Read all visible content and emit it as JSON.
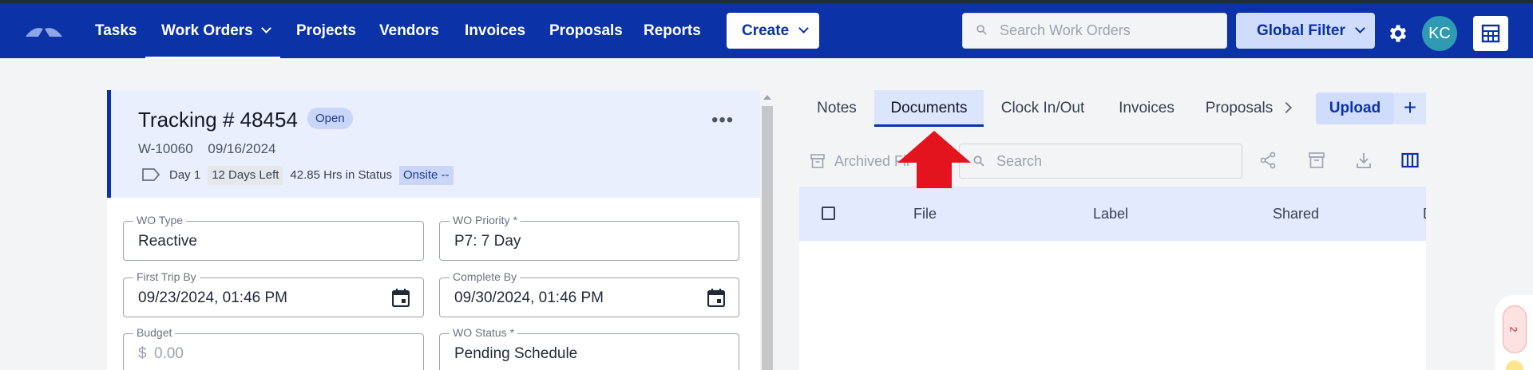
{
  "nav": {
    "items": [
      {
        "label": "Tasks",
        "dropdown": false
      },
      {
        "label": "Work Orders",
        "dropdown": true,
        "active": true
      },
      {
        "label": "Projects",
        "dropdown": false
      },
      {
        "label": "Vendors",
        "dropdown": false
      },
      {
        "label": "Invoices",
        "dropdown": false
      },
      {
        "label": "Proposals",
        "dropdown": false
      },
      {
        "label": "Reports",
        "dropdown": false
      }
    ],
    "create_label": "Create",
    "search_placeholder": "Search Work Orders",
    "global_filter_label": "Global Filter",
    "avatar_initials": "KC"
  },
  "work_order": {
    "tracking_label": "Tracking # 48454",
    "status": "Open",
    "wo_number": "W-10060",
    "date": "09/16/2024",
    "day": "Day 1",
    "days_left": "12 Days Left",
    "hrs_in_status": "42.85 Hrs in Status",
    "onsite": "Onsite --",
    "fields": {
      "wo_type": {
        "label": "WO Type",
        "value": "Reactive"
      },
      "wo_priority": {
        "label": "WO Priority *",
        "value": "P7: 7 Day"
      },
      "first_trip_by": {
        "label": "First Trip By",
        "value": "09/23/2024, 01:46 PM"
      },
      "complete_by": {
        "label": "Complete By",
        "value": "09/30/2024, 01:46 PM"
      },
      "budget": {
        "label": "Budget",
        "prefix": "$",
        "placeholder": "0.00"
      },
      "wo_status": {
        "label": "WO Status *",
        "value": "Pending Schedule"
      }
    }
  },
  "right_panel": {
    "tabs": [
      {
        "label": "Notes",
        "active": false
      },
      {
        "label": "Documents",
        "active": true
      },
      {
        "label": "Clock In/Out",
        "active": false
      },
      {
        "label": "Invoices",
        "active": false
      },
      {
        "label": "Proposals",
        "active": false
      }
    ],
    "upload_label": "Upload",
    "plus_label": "+",
    "archived_label": "Archived Fil",
    "search_placeholder": "Search",
    "columns": [
      "File",
      "Label",
      "Shared",
      "D"
    ]
  },
  "floating": {
    "badge": "2"
  },
  "colors": {
    "brand": "#0b32a6",
    "accent_light": "#cfdcfb",
    "arrow": "#e4141f"
  }
}
